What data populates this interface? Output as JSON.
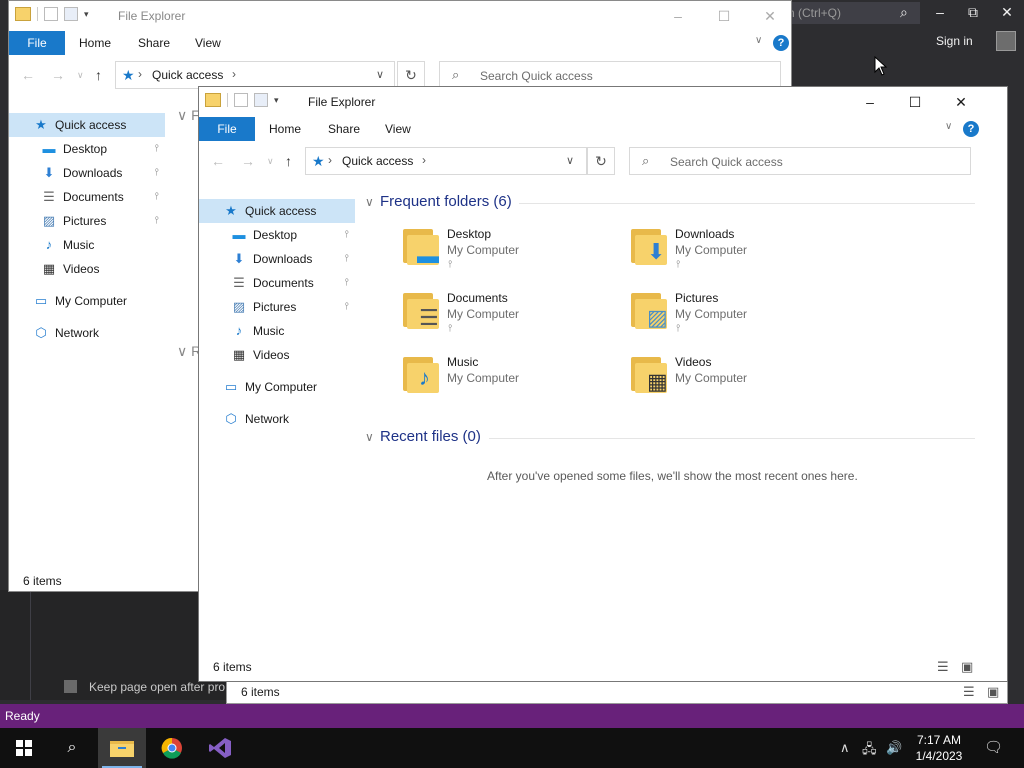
{
  "vs": {
    "search_placeholder": "n (Ctrl+Q)",
    "signin": "Sign in",
    "keep_page_open": "Keep page open after pro",
    "status": "Ready",
    "accent": "#68217a"
  },
  "back_window": {
    "title": "File Explorer",
    "tabs": {
      "file": "File",
      "home": "Home",
      "share": "Share",
      "view": "View"
    },
    "address": "Quick access",
    "search_placeholder": "Search Quick access",
    "sidebar": [
      {
        "label": "Quick access",
        "icon": "star-icon",
        "pinned": false
      },
      {
        "label": "Desktop",
        "icon": "desktop-icon",
        "pinned": true
      },
      {
        "label": "Downloads",
        "icon": "downloads-icon",
        "pinned": true
      },
      {
        "label": "Documents",
        "icon": "documents-icon",
        "pinned": true
      },
      {
        "label": "Pictures",
        "icon": "pictures-icon",
        "pinned": true
      },
      {
        "label": "Music",
        "icon": "music-icon",
        "pinned": false
      },
      {
        "label": "Videos",
        "icon": "videos-icon",
        "pinned": false
      },
      {
        "label": "My Computer",
        "icon": "computer-icon",
        "pinned": false
      },
      {
        "label": "Network",
        "icon": "network-icon",
        "pinned": false
      }
    ],
    "section_f": "F",
    "section_r": "R",
    "status": "6 items"
  },
  "front_window": {
    "title": "File Explorer",
    "tabs": {
      "file": "File",
      "home": "Home",
      "share": "Share",
      "view": "View"
    },
    "address": "Quick access",
    "search_placeholder": "Search Quick access",
    "sidebar": [
      {
        "label": "Quick access",
        "icon": "star-icon",
        "pinned": false
      },
      {
        "label": "Desktop",
        "icon": "desktop-icon",
        "pinned": true
      },
      {
        "label": "Downloads",
        "icon": "downloads-icon",
        "pinned": true
      },
      {
        "label": "Documents",
        "icon": "documents-icon",
        "pinned": true
      },
      {
        "label": "Pictures",
        "icon": "pictures-icon",
        "pinned": true
      },
      {
        "label": "Music",
        "icon": "music-icon",
        "pinned": false
      },
      {
        "label": "Videos",
        "icon": "videos-icon",
        "pinned": false
      },
      {
        "label": "My Computer",
        "icon": "computer-icon",
        "pinned": false
      },
      {
        "label": "Network",
        "icon": "network-icon",
        "pinned": false
      }
    ],
    "frequent_title": "Frequent folders (6)",
    "folders": [
      {
        "name": "Desktop",
        "location": "My Computer",
        "pinned": true,
        "icon": "desktop-folder-icon"
      },
      {
        "name": "Downloads",
        "location": "My Computer",
        "pinned": true,
        "icon": "downloads-folder-icon"
      },
      {
        "name": "Documents",
        "location": "My Computer",
        "pinned": true,
        "icon": "documents-folder-icon"
      },
      {
        "name": "Pictures",
        "location": "My Computer",
        "pinned": true,
        "icon": "pictures-folder-icon"
      },
      {
        "name": "Music",
        "location": "My Computer",
        "pinned": false,
        "icon": "music-folder-icon"
      },
      {
        "name": "Videos",
        "location": "My Computer",
        "pinned": false,
        "icon": "videos-folder-icon"
      }
    ],
    "recent_title": "Recent files (0)",
    "recent_empty": "After you've opened some files, we'll show the most recent ones here.",
    "status": "6 items",
    "status_outer": "6 items"
  },
  "taskbar": {
    "time": "7:17 AM",
    "date": "1/4/2023"
  }
}
